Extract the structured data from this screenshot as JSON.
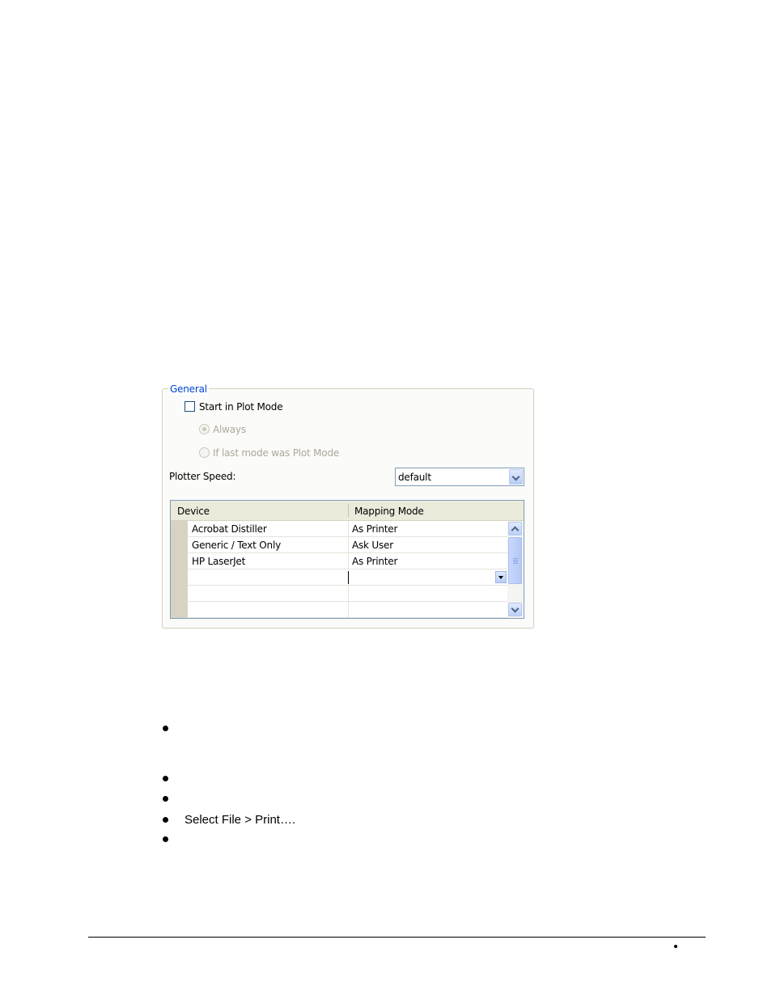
{
  "general": {
    "legend": "General",
    "start_plot_mode": "Start in Plot Mode",
    "always": "Always",
    "if_last_mode": "If last mode was Plot Mode",
    "plotter_speed_label": "Plotter Speed:",
    "plotter_speed_value": "default"
  },
  "grid": {
    "col_device": "Device",
    "col_mapping": "Mapping Mode",
    "rows": [
      {
        "device": "Acrobat Distiller",
        "mode": "As Printer"
      },
      {
        "device": "Generic / Text Only",
        "mode": "Ask User"
      },
      {
        "device": "HP LaserJet",
        "mode": "As Printer"
      },
      {
        "device": "",
        "mode": ""
      },
      {
        "device": "",
        "mode": ""
      },
      {
        "device": "",
        "mode": ""
      }
    ]
  },
  "bullets": {
    "b3": "Select File > Print…."
  }
}
